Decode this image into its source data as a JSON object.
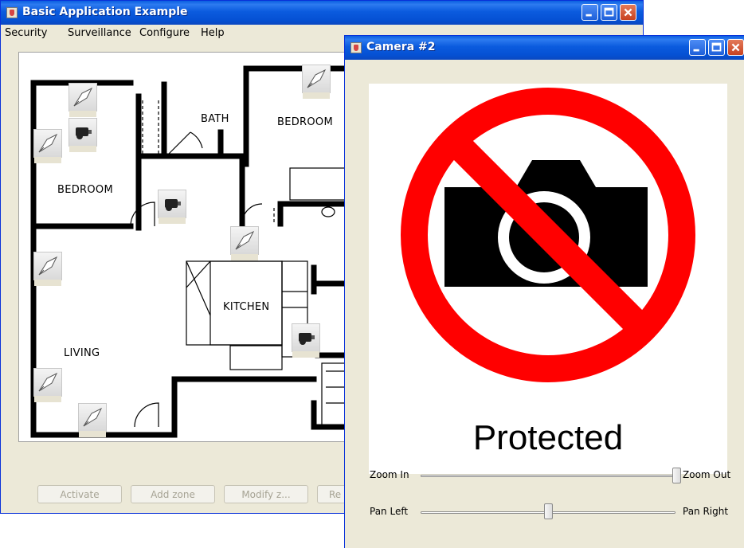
{
  "main_window": {
    "title": "Basic Application Example",
    "menu": [
      "Security",
      "Surveillance",
      "Configure",
      "Help"
    ],
    "rooms": [
      "BATH",
      "BEDROOM",
      "BEDROOM",
      "KITCHEN",
      "LIVING"
    ],
    "buttons": [
      "Activate",
      "Add zone",
      "Modify z...",
      "Re"
    ]
  },
  "camera_window": {
    "title": "Camera #2",
    "protected_text": "Protected",
    "zoom": {
      "left_label": "Zoom In",
      "right_label": "Zoom Out",
      "value": 1.0
    },
    "pan": {
      "left_label": "Pan Left",
      "right_label": "Pan Right",
      "value": 0.5
    },
    "colors": {
      "prohibition_red": "#ff0000"
    }
  },
  "icons": {
    "window_icon": "java-coffee-icon",
    "camera_sensor": "security-camera-icon",
    "motion_sensor": "light-sensor-icon"
  }
}
